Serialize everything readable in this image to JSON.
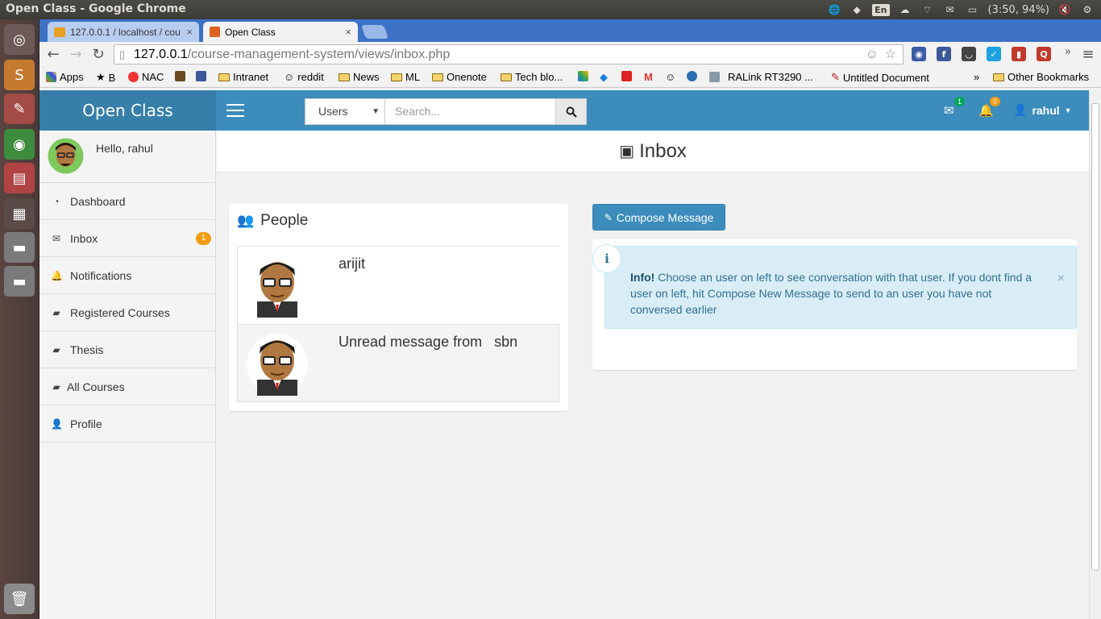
{
  "os": {
    "window_title": "Open Class - Google Chrome",
    "keyboard": "En",
    "battery": "(3:50, 94%)"
  },
  "browser": {
    "tabs": [
      {
        "label": "127.0.0.1 / localhost / cou",
        "active": false
      },
      {
        "label": "Open Class",
        "active": true
      }
    ],
    "url_host": "127.0.0.1",
    "url_path": "/course-management-system/views/inbox.php",
    "bookmarks": [
      "Apps",
      "B",
      "NAC",
      "Intranet",
      "reddit",
      "News",
      "ML",
      "Onenote",
      "Tech blo...",
      "RALink RT3290 ...",
      "Untitled Document"
    ],
    "more": "»",
    "other_bookmarks": "Other Bookmarks"
  },
  "app": {
    "brand": "Open Class",
    "search_select": "Users",
    "search_placeholder": "Search...",
    "mail_count": "1",
    "notif_count": "0",
    "username": "rahul"
  },
  "sidebar": {
    "hello": "Hello, rahul",
    "items": [
      {
        "label": "Dashboard",
        "icon": "dashboard-icon"
      },
      {
        "label": "Inbox",
        "icon": "envelope-icon",
        "badge": "1"
      },
      {
        "label": "Notifications",
        "icon": "bell-icon"
      },
      {
        "label": "Registered Courses",
        "icon": "book-icon"
      },
      {
        "label": "Thesis",
        "icon": "book-icon"
      },
      {
        "label": "All Courses",
        "icon": "book-icon"
      },
      {
        "label": "Profile",
        "icon": "user-icon"
      }
    ]
  },
  "main": {
    "page_title": "Inbox",
    "people_title": "People",
    "people": [
      {
        "name": "arijit"
      },
      {
        "name": "Unread message from   sbn"
      }
    ],
    "compose_label": "Compose Message",
    "info_strong": "Info!",
    "info_text": " Choose an user on left to see conversation with that user. If you dont find a user on left, hit Compose New Message to send to an user you have not conversed earlier",
    "close": "×"
  }
}
